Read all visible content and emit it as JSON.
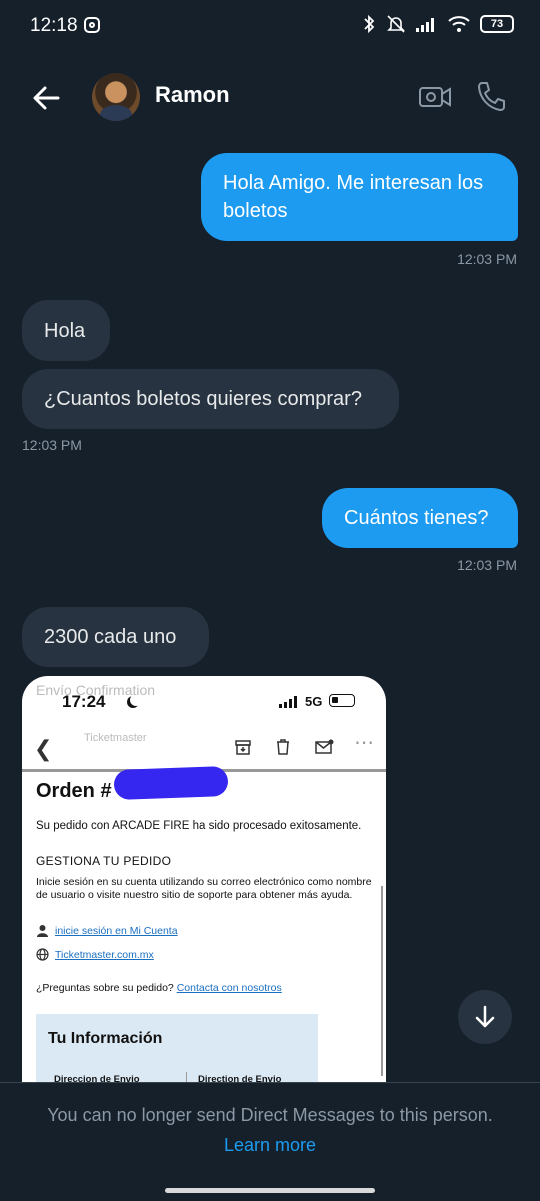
{
  "status_bar": {
    "time": "12:18",
    "battery": "73"
  },
  "header": {
    "contact_name": "Ramon"
  },
  "messages": [
    {
      "direction": "out",
      "text": "Hola Amigo. Me interesan los boletos"
    },
    {
      "timestamp": "12:03 PM"
    },
    {
      "direction": "in",
      "text": "Hola"
    },
    {
      "direction": "in",
      "text": "¿Cuantos boletos quieres comprar?"
    },
    {
      "timestamp": "12:03 PM"
    },
    {
      "direction": "out",
      "text": "Cuántos tienes?"
    },
    {
      "timestamp": "12:03 PM"
    },
    {
      "direction": "in",
      "text": "2300 cada uno"
    }
  ],
  "shared_image": {
    "time": "17:24",
    "network": "5G",
    "faded_header": "Envío Confirmation",
    "faded_sender": "Ticketmaster",
    "order_title": "Orden #",
    "order_line": "Su pedido con ARCADE FIRE ha sido procesado exitosamente.",
    "section_heading": "GESTIONA TU PEDIDO",
    "paragraph": "Inicie sesión en su cuenta utilizando su correo electrónico como nombre de usuario o visite nuestro sitio de soporte para obtener más ayuda.",
    "link_account": "inicie sesión en Mi Cuenta",
    "link_site": "Ticketmaster.com.mx",
    "question": "¿Preguntas sobre su pedido?",
    "contact_link": "Contacta con nosotros",
    "info_title": "Tu Información",
    "col1": "Direccion de Envio",
    "col2": "Direction de Envio"
  },
  "footer": {
    "message": "You can no longer send Direct Messages to this person.",
    "link": "Learn more"
  }
}
